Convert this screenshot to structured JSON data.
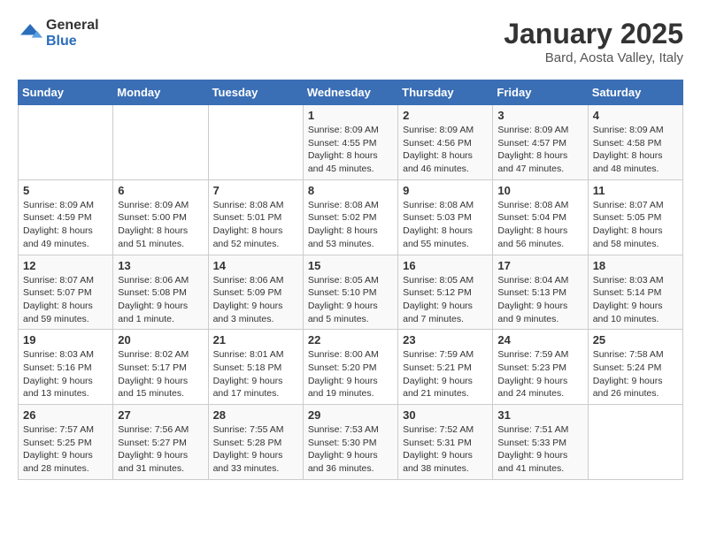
{
  "header": {
    "logo_general": "General",
    "logo_blue": "Blue",
    "month_title": "January 2025",
    "location": "Bard, Aosta Valley, Italy"
  },
  "days_of_week": [
    "Sunday",
    "Monday",
    "Tuesday",
    "Wednesday",
    "Thursday",
    "Friday",
    "Saturday"
  ],
  "weeks": [
    [
      {
        "day": "",
        "info": ""
      },
      {
        "day": "",
        "info": ""
      },
      {
        "day": "",
        "info": ""
      },
      {
        "day": "1",
        "info": "Sunrise: 8:09 AM\nSunset: 4:55 PM\nDaylight: 8 hours\nand 45 minutes."
      },
      {
        "day": "2",
        "info": "Sunrise: 8:09 AM\nSunset: 4:56 PM\nDaylight: 8 hours\nand 46 minutes."
      },
      {
        "day": "3",
        "info": "Sunrise: 8:09 AM\nSunset: 4:57 PM\nDaylight: 8 hours\nand 47 minutes."
      },
      {
        "day": "4",
        "info": "Sunrise: 8:09 AM\nSunset: 4:58 PM\nDaylight: 8 hours\nand 48 minutes."
      }
    ],
    [
      {
        "day": "5",
        "info": "Sunrise: 8:09 AM\nSunset: 4:59 PM\nDaylight: 8 hours\nand 49 minutes."
      },
      {
        "day": "6",
        "info": "Sunrise: 8:09 AM\nSunset: 5:00 PM\nDaylight: 8 hours\nand 51 minutes."
      },
      {
        "day": "7",
        "info": "Sunrise: 8:08 AM\nSunset: 5:01 PM\nDaylight: 8 hours\nand 52 minutes."
      },
      {
        "day": "8",
        "info": "Sunrise: 8:08 AM\nSunset: 5:02 PM\nDaylight: 8 hours\nand 53 minutes."
      },
      {
        "day": "9",
        "info": "Sunrise: 8:08 AM\nSunset: 5:03 PM\nDaylight: 8 hours\nand 55 minutes."
      },
      {
        "day": "10",
        "info": "Sunrise: 8:08 AM\nSunset: 5:04 PM\nDaylight: 8 hours\nand 56 minutes."
      },
      {
        "day": "11",
        "info": "Sunrise: 8:07 AM\nSunset: 5:05 PM\nDaylight: 8 hours\nand 58 minutes."
      }
    ],
    [
      {
        "day": "12",
        "info": "Sunrise: 8:07 AM\nSunset: 5:07 PM\nDaylight: 8 hours\nand 59 minutes."
      },
      {
        "day": "13",
        "info": "Sunrise: 8:06 AM\nSunset: 5:08 PM\nDaylight: 9 hours\nand 1 minute."
      },
      {
        "day": "14",
        "info": "Sunrise: 8:06 AM\nSunset: 5:09 PM\nDaylight: 9 hours\nand 3 minutes."
      },
      {
        "day": "15",
        "info": "Sunrise: 8:05 AM\nSunset: 5:10 PM\nDaylight: 9 hours\nand 5 minutes."
      },
      {
        "day": "16",
        "info": "Sunrise: 8:05 AM\nSunset: 5:12 PM\nDaylight: 9 hours\nand 7 minutes."
      },
      {
        "day": "17",
        "info": "Sunrise: 8:04 AM\nSunset: 5:13 PM\nDaylight: 9 hours\nand 9 minutes."
      },
      {
        "day": "18",
        "info": "Sunrise: 8:03 AM\nSunset: 5:14 PM\nDaylight: 9 hours\nand 10 minutes."
      }
    ],
    [
      {
        "day": "19",
        "info": "Sunrise: 8:03 AM\nSunset: 5:16 PM\nDaylight: 9 hours\nand 13 minutes."
      },
      {
        "day": "20",
        "info": "Sunrise: 8:02 AM\nSunset: 5:17 PM\nDaylight: 9 hours\nand 15 minutes."
      },
      {
        "day": "21",
        "info": "Sunrise: 8:01 AM\nSunset: 5:18 PM\nDaylight: 9 hours\nand 17 minutes."
      },
      {
        "day": "22",
        "info": "Sunrise: 8:00 AM\nSunset: 5:20 PM\nDaylight: 9 hours\nand 19 minutes."
      },
      {
        "day": "23",
        "info": "Sunrise: 7:59 AM\nSunset: 5:21 PM\nDaylight: 9 hours\nand 21 minutes."
      },
      {
        "day": "24",
        "info": "Sunrise: 7:59 AM\nSunset: 5:23 PM\nDaylight: 9 hours\nand 24 minutes."
      },
      {
        "day": "25",
        "info": "Sunrise: 7:58 AM\nSunset: 5:24 PM\nDaylight: 9 hours\nand 26 minutes."
      }
    ],
    [
      {
        "day": "26",
        "info": "Sunrise: 7:57 AM\nSunset: 5:25 PM\nDaylight: 9 hours\nand 28 minutes."
      },
      {
        "day": "27",
        "info": "Sunrise: 7:56 AM\nSunset: 5:27 PM\nDaylight: 9 hours\nand 31 minutes."
      },
      {
        "day": "28",
        "info": "Sunrise: 7:55 AM\nSunset: 5:28 PM\nDaylight: 9 hours\nand 33 minutes."
      },
      {
        "day": "29",
        "info": "Sunrise: 7:53 AM\nSunset: 5:30 PM\nDaylight: 9 hours\nand 36 minutes."
      },
      {
        "day": "30",
        "info": "Sunrise: 7:52 AM\nSunset: 5:31 PM\nDaylight: 9 hours\nand 38 minutes."
      },
      {
        "day": "31",
        "info": "Sunrise: 7:51 AM\nSunset: 5:33 PM\nDaylight: 9 hours\nand 41 minutes."
      },
      {
        "day": "",
        "info": ""
      }
    ]
  ]
}
